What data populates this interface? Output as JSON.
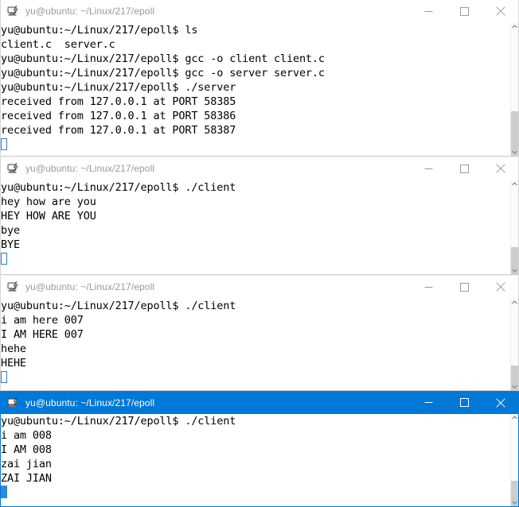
{
  "colors": {
    "active_titlebar": "#0078D7",
    "inactive_title_text": "#9A9A9A",
    "active_title_text": "#FFFFFF",
    "terminal_bg": "#FFFFFF",
    "terminal_fg": "#000000",
    "cursor": "#2E8BDC",
    "scrollbar_thumb": "#CDCDCD"
  },
  "window_controls": {
    "minimize_label": "Minimize",
    "maximize_label": "Maximize",
    "close_label": "Close",
    "minimize_icon": "minimize-icon",
    "maximize_icon": "maximize-icon",
    "close_icon": "close-icon",
    "app_icon": "putty-icon"
  },
  "scrollbar": {
    "up_arrow_icon": "scroll-up-arrow-icon",
    "down_arrow_icon": "scroll-down-arrow-icon"
  },
  "windows": [
    {
      "id": "window-server",
      "title": "yu@ubuntu: ~/Linux/217/epoll",
      "active": false,
      "has_scrollbar": true,
      "lines": [
        "yu@ubuntu:~/Linux/217/epoll$ ls",
        "client.c  server.c",
        "yu@ubuntu:~/Linux/217/epoll$ gcc -o client client.c",
        "yu@ubuntu:~/Linux/217/epoll$ gcc -o server server.c",
        "yu@ubuntu:~/Linux/217/epoll$ ./server",
        "received from 127.0.0.1 at PORT 58385",
        "received from 127.0.0.1 at PORT 58386",
        "received from 127.0.0.1 at PORT 58387"
      ],
      "cursor": "hollow"
    },
    {
      "id": "window-client-1",
      "title": "yu@ubuntu: ~/Linux/217/epoll",
      "active": false,
      "has_scrollbar": true,
      "lines": [
        "yu@ubuntu:~/Linux/217/epoll$ ./client",
        "hey how are you",
        "HEY HOW ARE YOU",
        "bye",
        "BYE"
      ],
      "cursor": "hollow"
    },
    {
      "id": "window-client-2",
      "title": "yu@ubuntu: ~/Linux/217/epoll",
      "active": false,
      "has_scrollbar": true,
      "lines": [
        "yu@ubuntu:~/Linux/217/epoll$ ./client",
        "i am here 007",
        "I AM HERE 007",
        "hehe",
        "HEHE"
      ],
      "cursor": "hollow"
    },
    {
      "id": "window-client-3",
      "title": "yu@ubuntu: ~/Linux/217/epoll",
      "active": true,
      "has_scrollbar": true,
      "lines": [
        "yu@ubuntu:~/Linux/217/epoll$ ./client",
        "i am 008",
        "I AM 008",
        "zai jian",
        "ZAI JIAN"
      ],
      "cursor": "solid"
    }
  ]
}
